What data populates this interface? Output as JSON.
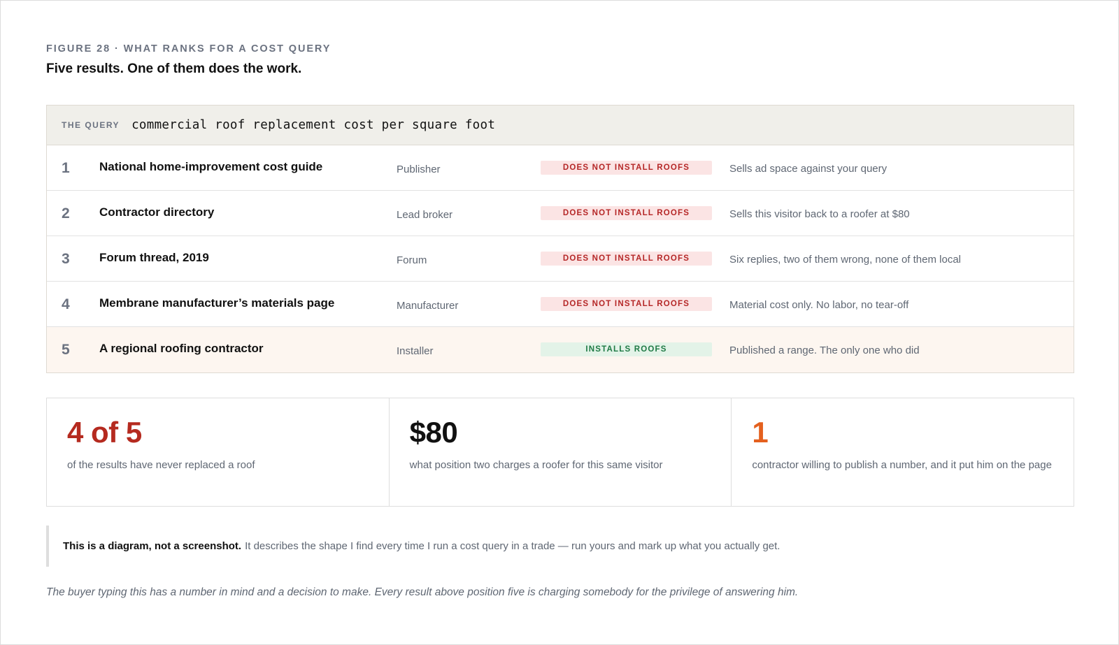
{
  "figure": {
    "eyebrow": "FIGURE 28 · WHAT RANKS FOR A COST QUERY",
    "headline": "Five results. One of them does the work."
  },
  "query": {
    "label": "THE QUERY",
    "text": "commercial roof replacement cost per square foot"
  },
  "results": [
    {
      "rank": "1",
      "site": "National home-improvement cost guide",
      "type": "Publisher",
      "badge": "DOES NOT INSTALL ROOFS",
      "installs": false,
      "note": "Sells ad space against your query"
    },
    {
      "rank": "2",
      "site": "Contractor directory",
      "type": "Lead broker",
      "badge": "DOES NOT INSTALL ROOFS",
      "installs": false,
      "note": "Sells this visitor back to a roofer at $80"
    },
    {
      "rank": "3",
      "site": "Forum thread, 2019",
      "type": "Forum",
      "badge": "DOES NOT INSTALL ROOFS",
      "installs": false,
      "note": "Six replies, two of them wrong, none of them local"
    },
    {
      "rank": "4",
      "site": "Membrane manufacturer’s materials page",
      "type": "Manufacturer",
      "badge": "DOES NOT INSTALL ROOFS",
      "installs": false,
      "note": "Material cost only. No labor, no tear-off"
    },
    {
      "rank": "5",
      "site": "A regional roofing contractor",
      "type": "Installer",
      "badge": "INSTALLS ROOFS",
      "installs": true,
      "note": "Published a range. The only one who did"
    }
  ],
  "stats": [
    {
      "value": "4 of 5",
      "desc": "of the results have never replaced a roof",
      "color": "#b52a1f"
    },
    {
      "value": "$80",
      "desc": "what position two charges a roofer for this same visitor",
      "color": "#111111"
    },
    {
      "value": "1",
      "desc": "contractor willing to publish a number, and it put him on the page",
      "color": "#e4601e"
    }
  ],
  "callout": {
    "lead": "This is a diagram, not a screenshot.",
    "body": "It describes the shape I find every time I run a cost query in a trade — run yours and mark up what you actually get."
  },
  "footnote": "The buyer typing this has a number in mind and a decision to make. Every result above position five is charging somebody for the privilege of answering him."
}
